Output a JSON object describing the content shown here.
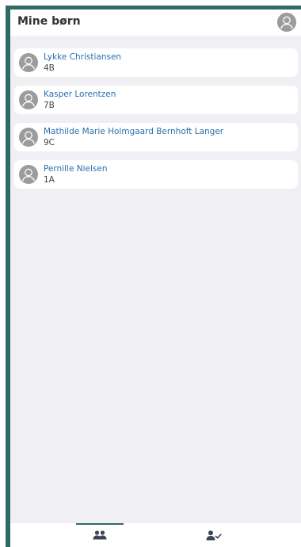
{
  "header": {
    "title": "Mine børn"
  },
  "children": [
    {
      "name": "Lykke Christiansen",
      "class": "4B"
    },
    {
      "name": "Kasper Lorentzen",
      "class": "7B"
    },
    {
      "name": "Mathilde Marie Holmgaard Bernhoft Langer",
      "class": "9C"
    },
    {
      "name": "Pernille Nielsen",
      "class": "1A"
    }
  ],
  "icons": {
    "profile": "user-avatar-icon",
    "children_tab": "users-icon",
    "absence_tab": "user-check-icon"
  },
  "colors": {
    "frame": "#2f6b64",
    "background": "#f0f0f4",
    "name_text": "#2a6fae",
    "avatar": "#9c9c9c",
    "nav_icon": "#3d4556"
  },
  "nav": {
    "active_tab": "children"
  }
}
